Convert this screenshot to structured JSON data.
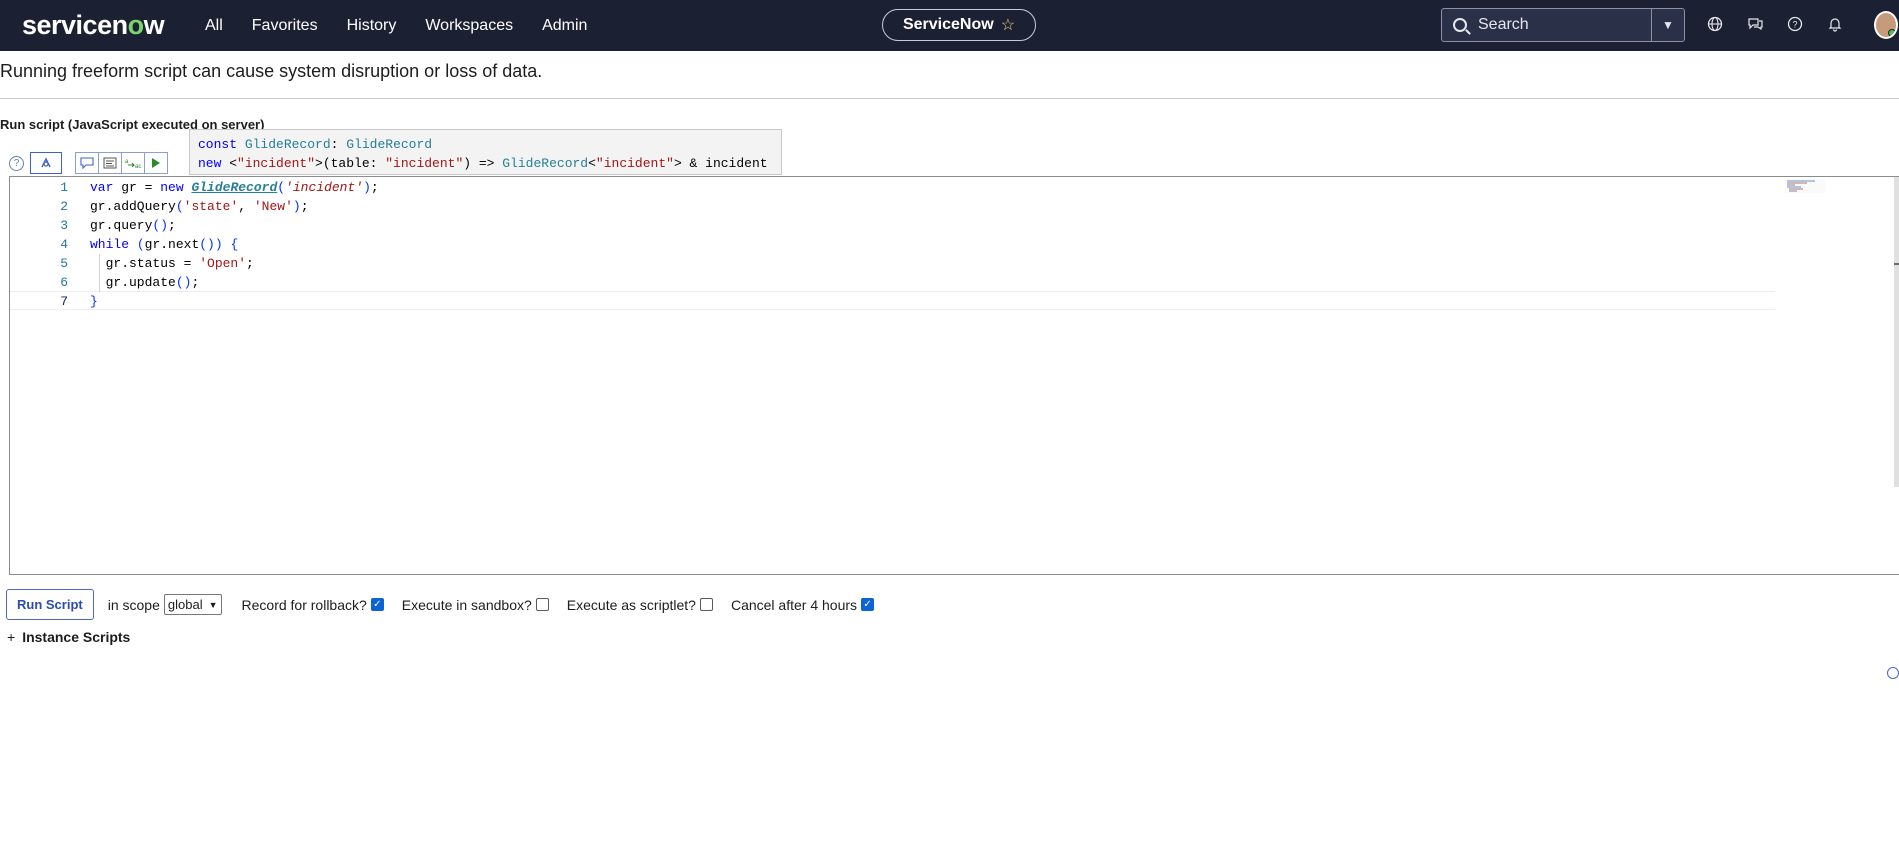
{
  "nav": {
    "logo_text_1": "servicen",
    "logo_text_2": "o",
    "logo_text_3": "w",
    "menu": [
      "All",
      "Favorites",
      "History",
      "Workspaces",
      "Admin"
    ],
    "instance_name": "ServiceNow",
    "search_placeholder": "Search",
    "icons": [
      "globe-icon",
      "chat-icon",
      "help-icon",
      "bell-icon"
    ]
  },
  "page": {
    "warning": "Running freeform script can cause system disruption or loss of data.",
    "run_label": "Run script (JavaScript executed on server)"
  },
  "toolbar": {
    "help": "?",
    "buttons": [
      "toggle-syntax-icon",
      "comment-icon",
      "format-icon",
      "replace-icon",
      "run-icon"
    ]
  },
  "tooltip": {
    "line1": "const GlideRecord: GlideRecord",
    "line2": "new <\"incident\">(table: \"incident\") =>   GlideRecord<\"incident\"> & incident"
  },
  "editor": {
    "lines": [
      {
        "n": "1",
        "text": "var gr = new GlideRecord('incident');"
      },
      {
        "n": "2",
        "text": "gr.addQuery('state', 'New');"
      },
      {
        "n": "3",
        "text": "gr.query();"
      },
      {
        "n": "4",
        "text": "while (gr.next()) {"
      },
      {
        "n": "5",
        "text": "  gr.status = 'Open';"
      },
      {
        "n": "6",
        "text": "  gr.update();"
      },
      {
        "n": "7",
        "text": "}"
      }
    ]
  },
  "controls": {
    "run_button": "Run Script",
    "scope_label": "in scope",
    "scope_value": "global",
    "record_rollback": {
      "label": "Record for rollback?",
      "checked": true
    },
    "sandbox": {
      "label": "Execute in sandbox?",
      "checked": false
    },
    "scriptlet": {
      "label": "Execute as scriptlet?",
      "checked": false
    },
    "cancel": {
      "label": "Cancel after 4 hours",
      "checked": true
    },
    "instance_scripts": "Instance Scripts",
    "instance_scripts_toggle": "+"
  }
}
